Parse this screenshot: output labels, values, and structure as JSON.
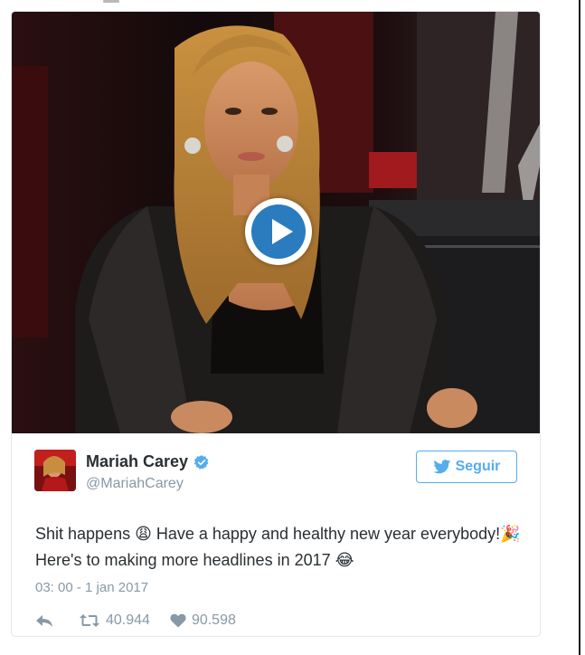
{
  "video": {
    "play_icon": "play-icon",
    "accent_color": "#2b7bbf"
  },
  "tweet": {
    "author_name": "Mariah Carey",
    "handle": "@MariahCarey",
    "verified_icon": "verified-badge-icon",
    "follow_label": "Seguir",
    "text_part1": "Shit happens ",
    "emoji1": "😩",
    "text_part2": " Have a happy and healthy new year everybody!",
    "emoji2": "🎉",
    "text_part3": " Here's to making more headlines in 2017 ",
    "emoji3": "😂",
    "timestamp": "03: 00 - 1 jan 2017",
    "retweet_count": "40.944",
    "like_count": "90.598",
    "link_color": "#55acee"
  }
}
